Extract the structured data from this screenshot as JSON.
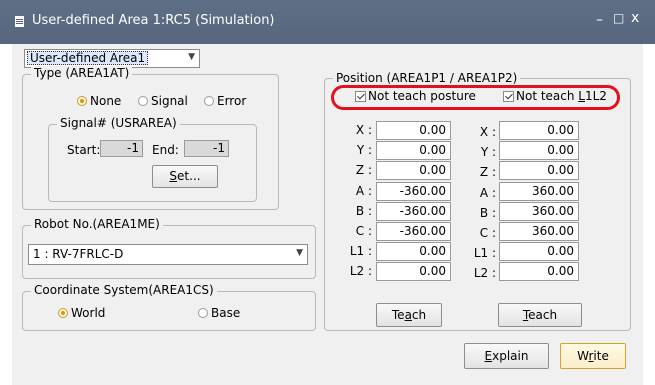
{
  "window": {
    "title": "User-defined Area 1:RC5  (Simulation)",
    "minimize_glyph": "–",
    "maximize_glyph": "□",
    "close_glyph": "x"
  },
  "area_select": {
    "value": "User-defined Area1"
  },
  "type_group": {
    "legend": "Type (AREA1AT)",
    "options": [
      "None",
      "Signal",
      "Error"
    ],
    "selected": "None"
  },
  "signal_group": {
    "legend": "Signal# (USRAREA)",
    "start_label": "Start:",
    "start_value": "-1",
    "end_label": "End:",
    "end_value": "-1",
    "set_button": {
      "pre": "",
      "ul": "S",
      "post": "et..."
    }
  },
  "robot_group": {
    "legend": "Robot No.(AREA1ME)",
    "value": "1 : RV-7FRLC-D"
  },
  "coord_group": {
    "legend": "Coordinate System(AREA1CS)",
    "options": [
      "World",
      "Base"
    ],
    "selected": "World"
  },
  "position_group": {
    "legend": "Position (AREA1P1 / AREA1P2)",
    "checkbox_posture": "Not teach posture",
    "checkbox_l1l2": {
      "pre": "Not teach ",
      "ul": "L",
      "post": "1L2"
    },
    "labels": [
      "X :",
      "Y :",
      "Z :",
      "A :",
      "B :",
      "C :",
      "L1 :",
      "L2 :"
    ],
    "p1": [
      "0.00",
      "0.00",
      "0.00",
      "-360.00",
      "-360.00",
      "-360.00",
      "0.00",
      "0.00"
    ],
    "p2": [
      "0.00",
      "0.00",
      "0.00",
      "360.00",
      "360.00",
      "360.00",
      "0.00",
      "0.00"
    ],
    "teach_button_1": {
      "pre": "Te",
      "ul": "a",
      "post": "ch"
    },
    "teach_button_2": {
      "pre": "",
      "ul": "T",
      "post": "each"
    }
  },
  "footer": {
    "explain_button": {
      "pre": "",
      "ul": "E",
      "post": "xplain"
    },
    "write_button": {
      "pre": "W",
      "ul": "r",
      "post": "ite"
    }
  },
  "colors": {
    "titlebar": "#56667d",
    "client_bg": "#f0f0f0",
    "highlight": "#e4101d",
    "radio_selected": "#e09218"
  }
}
